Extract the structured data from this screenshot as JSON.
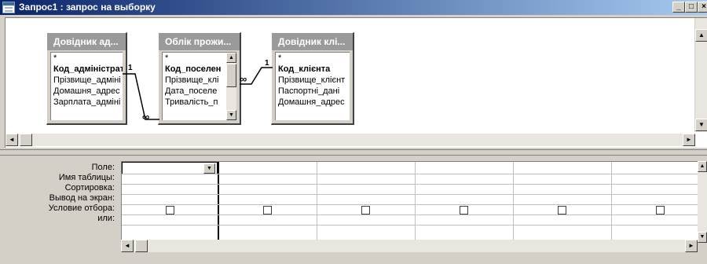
{
  "window": {
    "title": "Запрос1 : запрос на выборку",
    "controls": {
      "minimize": "_",
      "maximize": "□",
      "close": "×"
    }
  },
  "tables": [
    {
      "title": "Довідник ад...",
      "fields": [
        "*",
        "Код_адміністрат",
        "Прізвище_адміні",
        "Домашня_адрес",
        "Зарплата_адміні"
      ],
      "bold_fields": [
        1
      ]
    },
    {
      "title": "Облік прожи...",
      "fields": [
        "*",
        "Код_поселен",
        "Прізвище_клі",
        "Дата_поселе",
        "Тривалість_п"
      ],
      "bold_fields": [
        1
      ]
    },
    {
      "title": "Довідник клі...",
      "fields": [
        "*",
        "Код_клієнта",
        "Прізвище_клієнт",
        "Паспортні_дані",
        "Домашня_адрес"
      ],
      "bold_fields": [
        1
      ]
    }
  ],
  "relationships": [
    {
      "from_label": "1",
      "to_label": "∞"
    },
    {
      "from_label": "∞",
      "to_label": "1"
    }
  ],
  "grid": {
    "row_labels": [
      "Поле:",
      "Имя таблицы:",
      "Сортировка:",
      "Вывод на экран:",
      "Условие отбора:",
      "или:"
    ],
    "column_count": 6,
    "show_checked": [
      false,
      false,
      false,
      false,
      false,
      false
    ]
  },
  "icons": {
    "app": "query-icon",
    "scroll_up": "▲",
    "scroll_down": "▼",
    "scroll_left": "◄",
    "scroll_right": "►",
    "dropdown": "▼"
  },
  "colors": {
    "title_start": "#0a246a",
    "title_end": "#a6caf0",
    "table_header_inactive": "#9a9a9a",
    "face": "#d4d0c8"
  }
}
